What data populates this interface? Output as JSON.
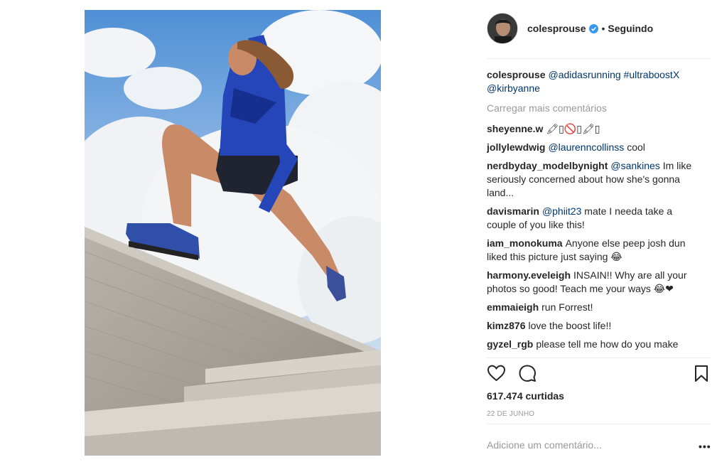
{
  "post": {
    "image_alt": "Woman running and jumping over concrete steps"
  },
  "header": {
    "username": "colesprouse",
    "separator": "•",
    "follow_status": "Seguindo"
  },
  "caption": {
    "username": "colesprouse",
    "mentions": [
      "@adidasrunning",
      "#ultraboostX",
      "@kirbyanne"
    ]
  },
  "load_more": "Carregar mais comentários",
  "comments": [
    {
      "user": "sheyenne.w",
      "mention": "",
      "text": "🖍▯🚫▯🖍▯"
    },
    {
      "user": "jollylewdwig",
      "mention": "@laurenncollinss",
      "text": "cool"
    },
    {
      "user": "nerdbyday_modelbynight",
      "mention": "@sankines",
      "text": "Im like seriously concerned about how she's gonna land..."
    },
    {
      "user": "davismarin",
      "mention": "@phiit23",
      "text": "mate I needa take a couple of you like this!"
    },
    {
      "user": "iam_monokuma",
      "mention": "",
      "text": "Anyone else peep josh dun liked this picture just saying 😂"
    },
    {
      "user": "harmony.eveleigh",
      "mention": "",
      "text": "INSAIN!! Why are all your photos so good! Teach me your ways 😂❤"
    },
    {
      "user": "emmaieigh",
      "mention": "",
      "text": "run Forrest!"
    },
    {
      "user": "kimz876",
      "mention": "",
      "text": "love the boost life!!"
    },
    {
      "user": "gyzel_rgb",
      "mention": "",
      "text": "please tell me how do you make"
    }
  ],
  "likes": "617.474 curtidas",
  "date": "22 DE JUNHO",
  "add_comment_placeholder": "Adicione um comentário...",
  "more_options": "•••",
  "colors": {
    "link": "#003569",
    "muted": "#999999",
    "verified": "#3897f0",
    "text": "#262626"
  }
}
